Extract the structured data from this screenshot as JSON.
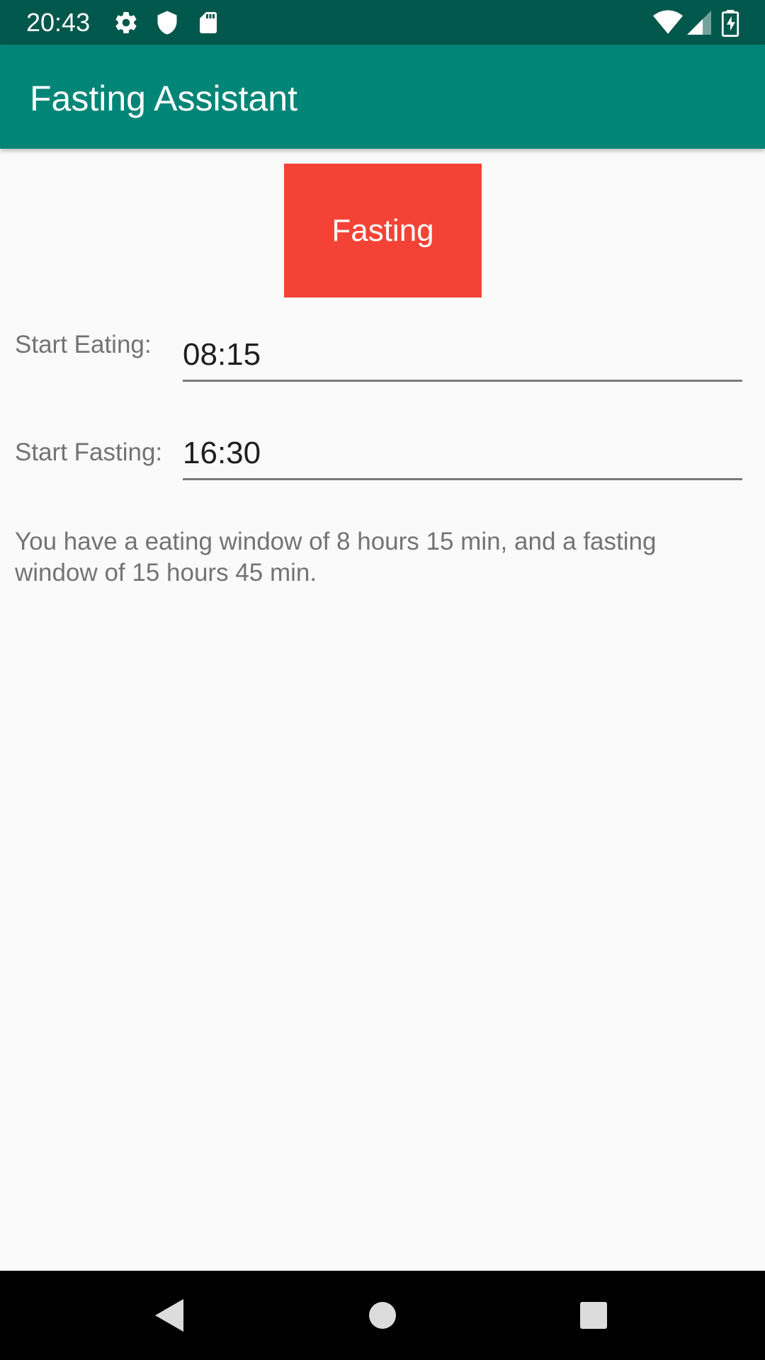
{
  "status_bar": {
    "time": "20:43",
    "icons_left": [
      "gear-icon",
      "shield-icon",
      "sd-card-icon"
    ],
    "icons_right": [
      "wifi-icon",
      "signal-icon",
      "battery-charging-icon"
    ]
  },
  "app_bar": {
    "title": "Fasting Assistant",
    "color": "#008577"
  },
  "status_button": {
    "label": "Fasting",
    "color": "#f44336"
  },
  "form": {
    "start_eating_label": "Start Eating:",
    "start_eating_value": "08:15",
    "start_fasting_label": "Start Fasting:",
    "start_fasting_value": "16:30"
  },
  "summary": "You have a eating window of 8 hours 15 min, and a fasting window of 15 hours 45 min.",
  "nav_bar": {
    "buttons": [
      "back-icon",
      "home-icon",
      "recents-icon"
    ]
  }
}
